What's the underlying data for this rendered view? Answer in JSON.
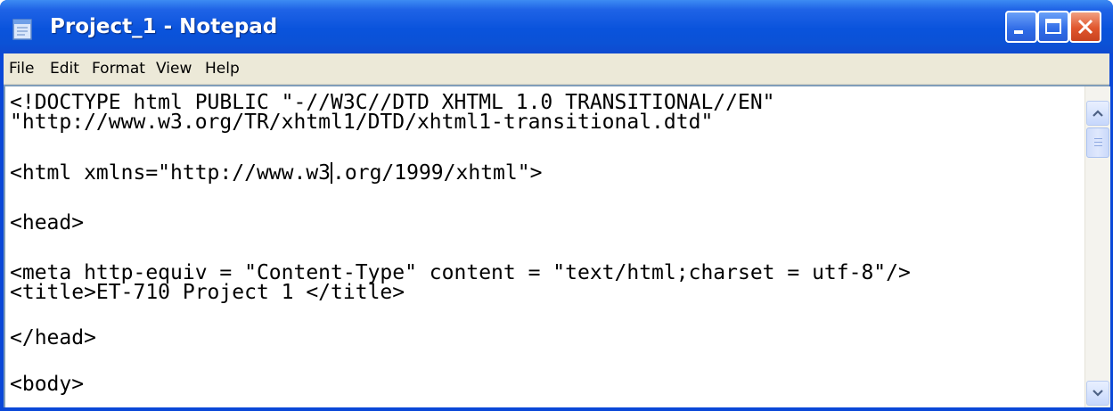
{
  "window": {
    "title": "Project_1 - Notepad",
    "app_icon": "notepad-icon",
    "controls": {
      "minimize_icon": "minimize-icon",
      "maximize_icon": "maximize-icon",
      "close_icon": "close-icon"
    }
  },
  "menu": {
    "items": [
      "File",
      "Edit",
      "Format",
      "View",
      "Help"
    ]
  },
  "editor": {
    "lines": [
      "<!DOCTYPE html PUBLIC \"-//W3C//DTD XHTML 1.0 TRANSITIONAL//EN\"",
      "\"http://www.w3.org/TR/xhtml1/DTD/xhtml1-transitional.dtd\"",
      "",
      "<html xmlns=\"http://www.w3",
      ".org/1999/xhtml\">",
      "",
      "<head>",
      "",
      "<meta http-equiv = \"Content-Type\" content = \"text/html;charset = utf-8\"/>",
      "<title>ET-710 Project 1 </title>",
      "",
      "</head>",
      "",
      "<body>"
    ]
  },
  "scrollbar": {
    "up_icon": "scroll-up-arrow-icon",
    "down_icon": "scroll-down-arrow-icon"
  },
  "colors": {
    "titlebar": "#0a53dc",
    "menubar": "#ece9d8",
    "close_button": "#e0562d"
  }
}
